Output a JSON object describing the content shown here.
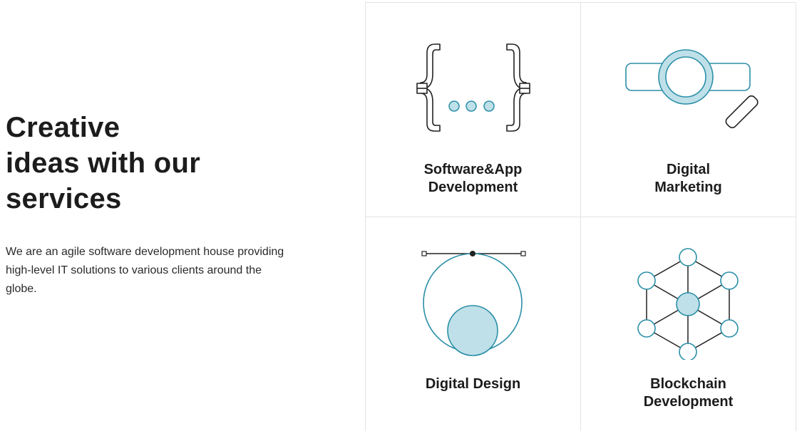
{
  "intro": {
    "heading_lines": [
      "Creative",
      "ideas with our",
      "services"
    ],
    "description": "We are an agile software development house providing high-level IT solutions to various clients around the globe."
  },
  "services": [
    {
      "icon": "code-braces-icon",
      "label_lines": [
        "Software&App",
        "Development"
      ]
    },
    {
      "icon": "magnifier-search-icon",
      "label_lines": [
        "Digital",
        "Marketing"
      ]
    },
    {
      "icon": "vector-pen-icon",
      "label_lines": [
        "Digital Design"
      ]
    },
    {
      "icon": "blockchain-network-icon",
      "label_lines": [
        "Blockchain",
        "Development"
      ]
    }
  ],
  "colors": {
    "accent_fill": "#bfe0e8",
    "accent_stroke": "#2b8fa8",
    "text": "#1c1c1c",
    "border": "#e3e3e3"
  }
}
